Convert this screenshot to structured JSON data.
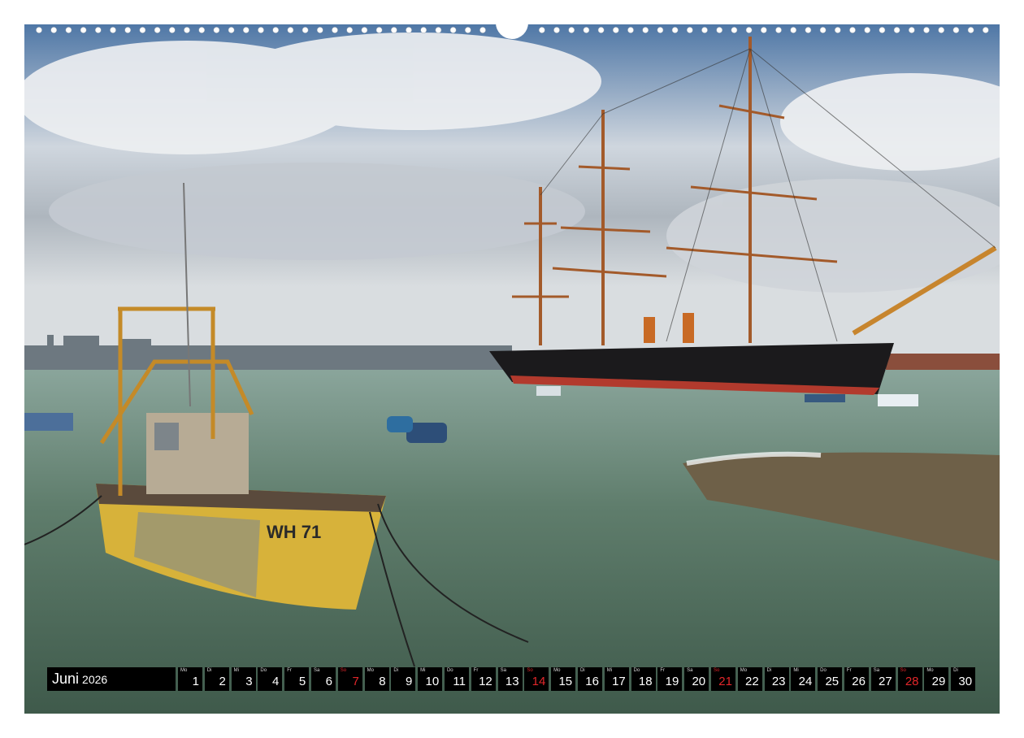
{
  "calendar": {
    "month": "Juni",
    "year": "2026",
    "days": [
      {
        "wd": "Mo",
        "n": "1"
      },
      {
        "wd": "Di",
        "n": "2"
      },
      {
        "wd": "Mi",
        "n": "3"
      },
      {
        "wd": "Do",
        "n": "4"
      },
      {
        "wd": "Fr",
        "n": "5"
      },
      {
        "wd": "Sa",
        "n": "6"
      },
      {
        "wd": "So",
        "n": "7",
        "sun": true
      },
      {
        "wd": "Mo",
        "n": "8"
      },
      {
        "wd": "Di",
        "n": "9"
      },
      {
        "wd": "Mi",
        "n": "10"
      },
      {
        "wd": "Do",
        "n": "11"
      },
      {
        "wd": "Fr",
        "n": "12"
      },
      {
        "wd": "Sa",
        "n": "13"
      },
      {
        "wd": "So",
        "n": "14",
        "sun": true
      },
      {
        "wd": "Mo",
        "n": "15"
      },
      {
        "wd": "Di",
        "n": "16"
      },
      {
        "wd": "Mi",
        "n": "17"
      },
      {
        "wd": "Do",
        "n": "18"
      },
      {
        "wd": "Fr",
        "n": "19"
      },
      {
        "wd": "Sa",
        "n": "20"
      },
      {
        "wd": "So",
        "n": "21",
        "sun": true
      },
      {
        "wd": "Mo",
        "n": "22"
      },
      {
        "wd": "Di",
        "n": "23"
      },
      {
        "wd": "Mi",
        "n": "24"
      },
      {
        "wd": "Do",
        "n": "25"
      },
      {
        "wd": "Fr",
        "n": "26"
      },
      {
        "wd": "Sa",
        "n": "27"
      },
      {
        "wd": "So",
        "n": "28",
        "sun": true
      },
      {
        "wd": "Mo",
        "n": "29"
      },
      {
        "wd": "Di",
        "n": "30"
      }
    ],
    "sunday_color": "#e3262a"
  },
  "photo": {
    "boat_registration": "WH 71"
  }
}
